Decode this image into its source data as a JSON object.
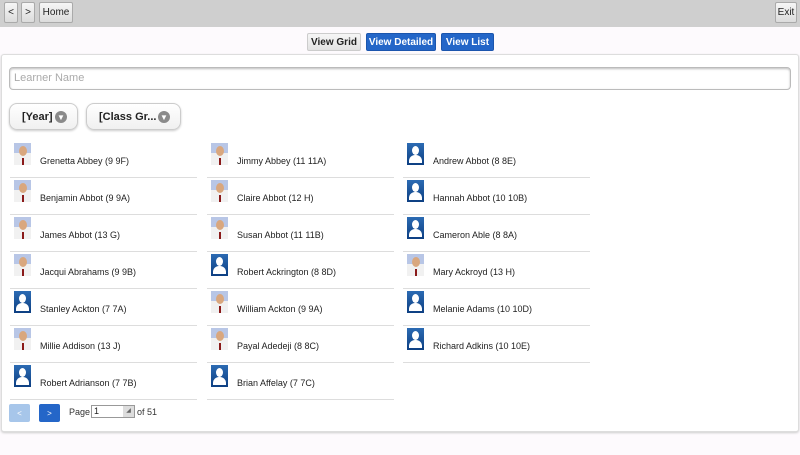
{
  "topbar": {
    "back": "<",
    "forward": ">",
    "home": "Home",
    "exit": "Exit"
  },
  "views": {
    "grid": "View Grid",
    "detailed": "View Detailed",
    "list": "View List"
  },
  "search": {
    "placeholder": "Learner Name"
  },
  "filters": {
    "year": "[Year]",
    "class_group": "[Class Gr..."
  },
  "columns": [
    [
      {
        "name": "Grenetta Abbey (9 9F)",
        "photo": true
      },
      {
        "name": "Benjamin Abbot (9 9A)",
        "photo": true
      },
      {
        "name": "James Abbot (13 G)",
        "photo": true
      },
      {
        "name": "Jacqui Abrahams (9 9B)",
        "photo": true
      },
      {
        "name": "Stanley Ackton (7 7A)",
        "photo": false
      },
      {
        "name": "Millie Addison (13 J)",
        "photo": true
      },
      {
        "name": "Robert Adrianson (7 7B)",
        "photo": false
      }
    ],
    [
      {
        "name": "Jimmy Abbey (11 11A)",
        "photo": true
      },
      {
        "name": "Claire Abbot (12 H)",
        "photo": true
      },
      {
        "name": "Susan Abbot (11 11B)",
        "photo": true
      },
      {
        "name": "Robert Ackrington (8 8D)",
        "photo": false
      },
      {
        "name": "William Ackton (9 9A)",
        "photo": true
      },
      {
        "name": "Payal Adedeji (8 8C)",
        "photo": true
      },
      {
        "name": "Brian Affelay (7 7C)",
        "photo": false
      }
    ],
    [
      {
        "name": "Andrew Abbot (8 8E)",
        "photo": false
      },
      {
        "name": "Hannah Abbot (10 10B)",
        "photo": false
      },
      {
        "name": "Cameron Able (8 8A)",
        "photo": false
      },
      {
        "name": "Mary Ackroyd (13 H)",
        "photo": true
      },
      {
        "name": "Melanie Adams (10 10D)",
        "photo": false
      },
      {
        "name": "Richard Adkins (10 10E)",
        "photo": false
      }
    ]
  ],
  "pager": {
    "prev": "<",
    "next": ">",
    "page_label": "Page",
    "page": "1",
    "of_label": "of 51"
  }
}
